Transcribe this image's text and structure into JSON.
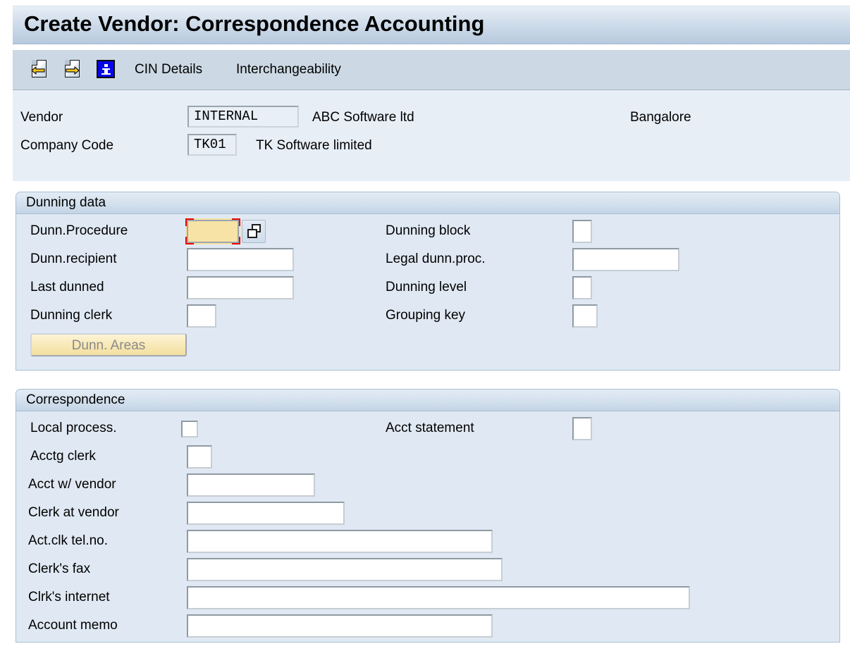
{
  "window": {
    "title": "Create Vendor: Correspondence Accounting"
  },
  "toolbar": {
    "icons": [
      {
        "name": "previous-page-icon",
        "label": ""
      },
      {
        "name": "next-page-icon",
        "label": ""
      },
      {
        "name": "information-icon",
        "label": ""
      }
    ],
    "links": [
      {
        "label": "CIN Details"
      },
      {
        "label": "Interchangeability"
      }
    ]
  },
  "header": {
    "vendor_label": "Vendor",
    "vendor_value": "INTERNAL",
    "vendor_name": "ABC Software ltd",
    "vendor_city": "Bangalore",
    "company_code_label": "Company Code",
    "company_code_value": "TK01",
    "company_code_name": "TK Software limited"
  },
  "dunning": {
    "title": "Dunning data",
    "fields": {
      "dunn_procedure_label": "Dunn.Procedure",
      "dunn_procedure_value": "",
      "dunn_recipient_label": "Dunn.recipient",
      "dunn_recipient_value": "",
      "last_dunned_label": "Last dunned",
      "last_dunned_value": "",
      "dunning_clerk_label": "Dunning clerk",
      "dunning_clerk_value": "",
      "dunning_block_label": "Dunning block",
      "dunning_block_value": "",
      "legal_dunn_proc_label": "Legal dunn.proc.",
      "legal_dunn_proc_value": "",
      "dunning_level_label": "Dunning level",
      "dunning_level_value": "",
      "grouping_key_label": "Grouping key",
      "grouping_key_value": ""
    },
    "dunn_areas_button": "Dunn. Areas"
  },
  "correspondence": {
    "title": "Correspondence",
    "fields": {
      "local_process_label": "Local process.",
      "acct_statement_label": "Acct statement",
      "acct_statement_value": "",
      "acctg_clerk_label": "Acctg clerk",
      "acctg_clerk_value": "",
      "acct_w_vendor_label": "Acct w/ vendor",
      "acct_w_vendor_value": "",
      "clerk_at_vendor_label": "Clerk at vendor",
      "clerk_at_vendor_value": "",
      "act_clk_tel_label": "Act.clk tel.no.",
      "act_clk_tel_value": "",
      "clerks_fax_label": "Clerk's fax",
      "clerks_fax_value": "",
      "clrks_internet_label": "Clrk's internet",
      "clrks_internet_value": "",
      "account_memo_label": "Account memo",
      "account_memo_value": ""
    }
  },
  "colors": {
    "title_bar": "#cfdcea",
    "toolbar": "#ccd9e4",
    "panel_bg": "#e0e9f3",
    "header_bg": "#e8eef6",
    "focus_outline": "#ee0000",
    "focused_field": "#f8e3a6",
    "button_face": "#f8e9b8"
  }
}
